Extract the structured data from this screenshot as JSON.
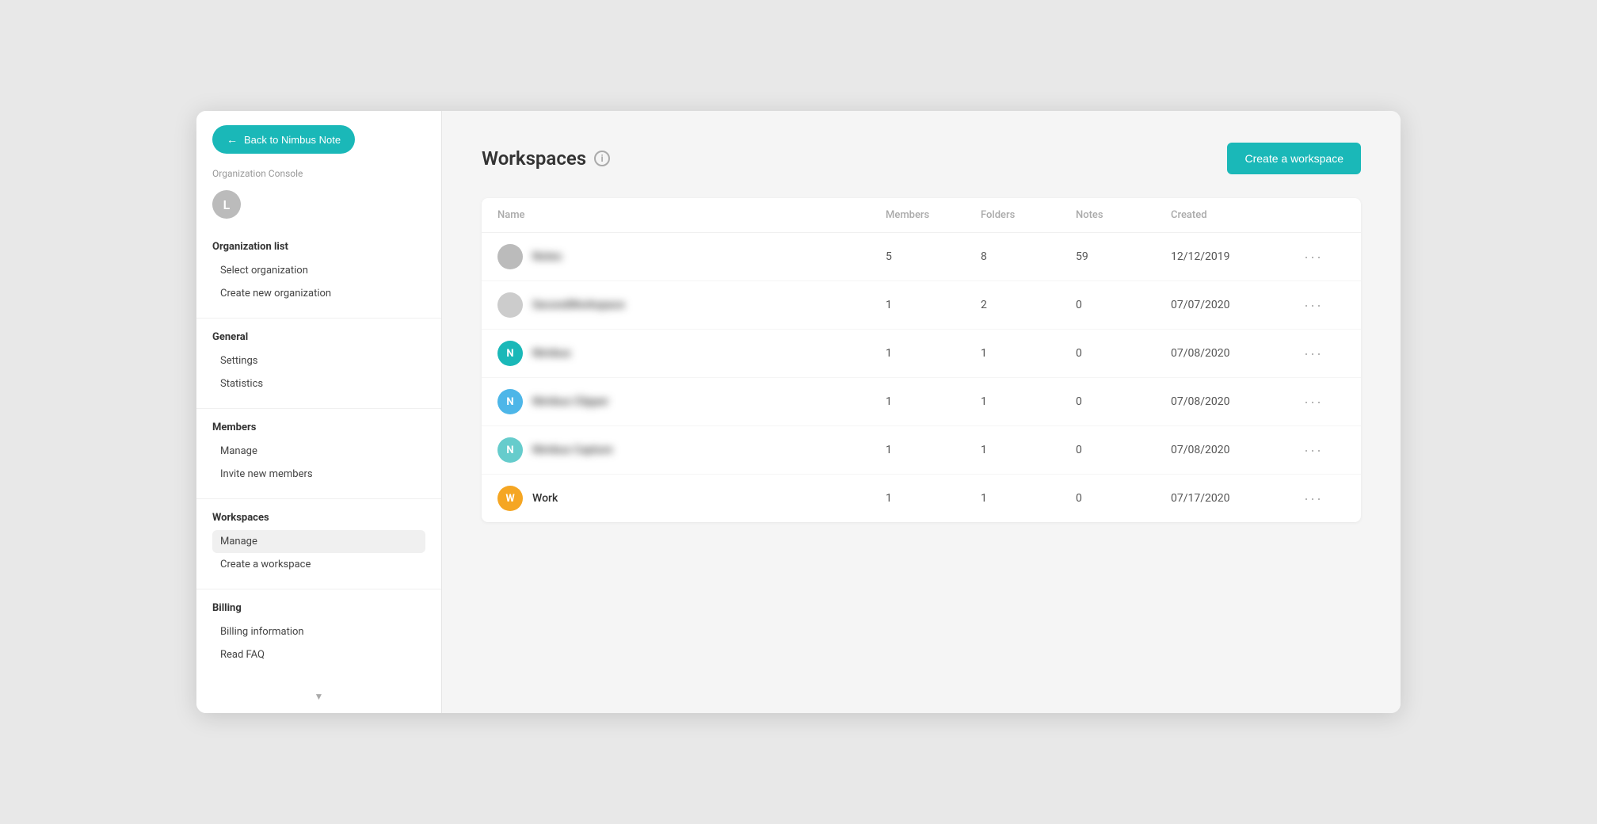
{
  "app": {
    "window_title": "Organization Console"
  },
  "back_button": {
    "label": "Back to Nimbus Note",
    "arrow": "←"
  },
  "sidebar": {
    "org_console_label": "Organization Console",
    "org_avatar_letter": "L",
    "sections": [
      {
        "id": "organization_list",
        "title": "Organization list",
        "items": [
          {
            "id": "select_organization",
            "label": "Select organization",
            "active": false
          },
          {
            "id": "create_new_organization",
            "label": "Create new organization",
            "active": false
          }
        ]
      },
      {
        "id": "general",
        "title": "General",
        "items": [
          {
            "id": "settings",
            "label": "Settings",
            "active": false
          },
          {
            "id": "statistics",
            "label": "Statistics",
            "active": false
          }
        ]
      },
      {
        "id": "members",
        "title": "Members",
        "items": [
          {
            "id": "members_manage",
            "label": "Manage",
            "active": false
          },
          {
            "id": "invite_new_members",
            "label": "Invite new members",
            "active": false
          }
        ]
      },
      {
        "id": "workspaces",
        "title": "Workspaces",
        "items": [
          {
            "id": "workspaces_manage",
            "label": "Manage",
            "active": true
          },
          {
            "id": "create_a_workspace",
            "label": "Create a workspace",
            "active": false
          }
        ]
      },
      {
        "id": "billing",
        "title": "Billing",
        "items": [
          {
            "id": "billing_information",
            "label": "Billing information",
            "active": false
          },
          {
            "id": "read_faq",
            "label": "Read FAQ",
            "active": false
          }
        ]
      }
    ]
  },
  "main": {
    "page_title": "Workspaces",
    "create_button_label": "Create a workspace",
    "table": {
      "columns": [
        "Name",
        "Members",
        "Folders",
        "Notes",
        "Created",
        ""
      ],
      "rows": [
        {
          "id": "row1",
          "name": "Notes",
          "name_blurred": true,
          "avatar_color": "#bbb",
          "avatar_letter": "",
          "members": "5",
          "folders": "8",
          "notes": "59",
          "created": "12/12/2019"
        },
        {
          "id": "row2",
          "name": "SecondWorkspace",
          "name_blurred": true,
          "avatar_color": "#ccc",
          "avatar_letter": "",
          "members": "1",
          "folders": "2",
          "notes": "0",
          "created": "07/07/2020"
        },
        {
          "id": "row3",
          "name": "Nimbus",
          "name_blurred": true,
          "avatar_color": "#1ab8b8",
          "avatar_letter": "N",
          "members": "1",
          "folders": "1",
          "notes": "0",
          "created": "07/08/2020"
        },
        {
          "id": "row4",
          "name": "Nimbus Clipper",
          "name_blurred": true,
          "avatar_color": "#4db6e8",
          "avatar_letter": "N",
          "members": "1",
          "folders": "1",
          "notes": "0",
          "created": "07/08/2020"
        },
        {
          "id": "row5",
          "name": "Nimbus Capture",
          "name_blurred": true,
          "avatar_color": "#6cc",
          "avatar_letter": "N",
          "members": "1",
          "folders": "1",
          "notes": "0",
          "created": "07/08/2020"
        },
        {
          "id": "row6",
          "name": "Work",
          "name_blurred": false,
          "avatar_color": "#f5a623",
          "avatar_letter": "W",
          "members": "1",
          "folders": "1",
          "notes": "0",
          "created": "07/17/2020"
        }
      ]
    }
  }
}
